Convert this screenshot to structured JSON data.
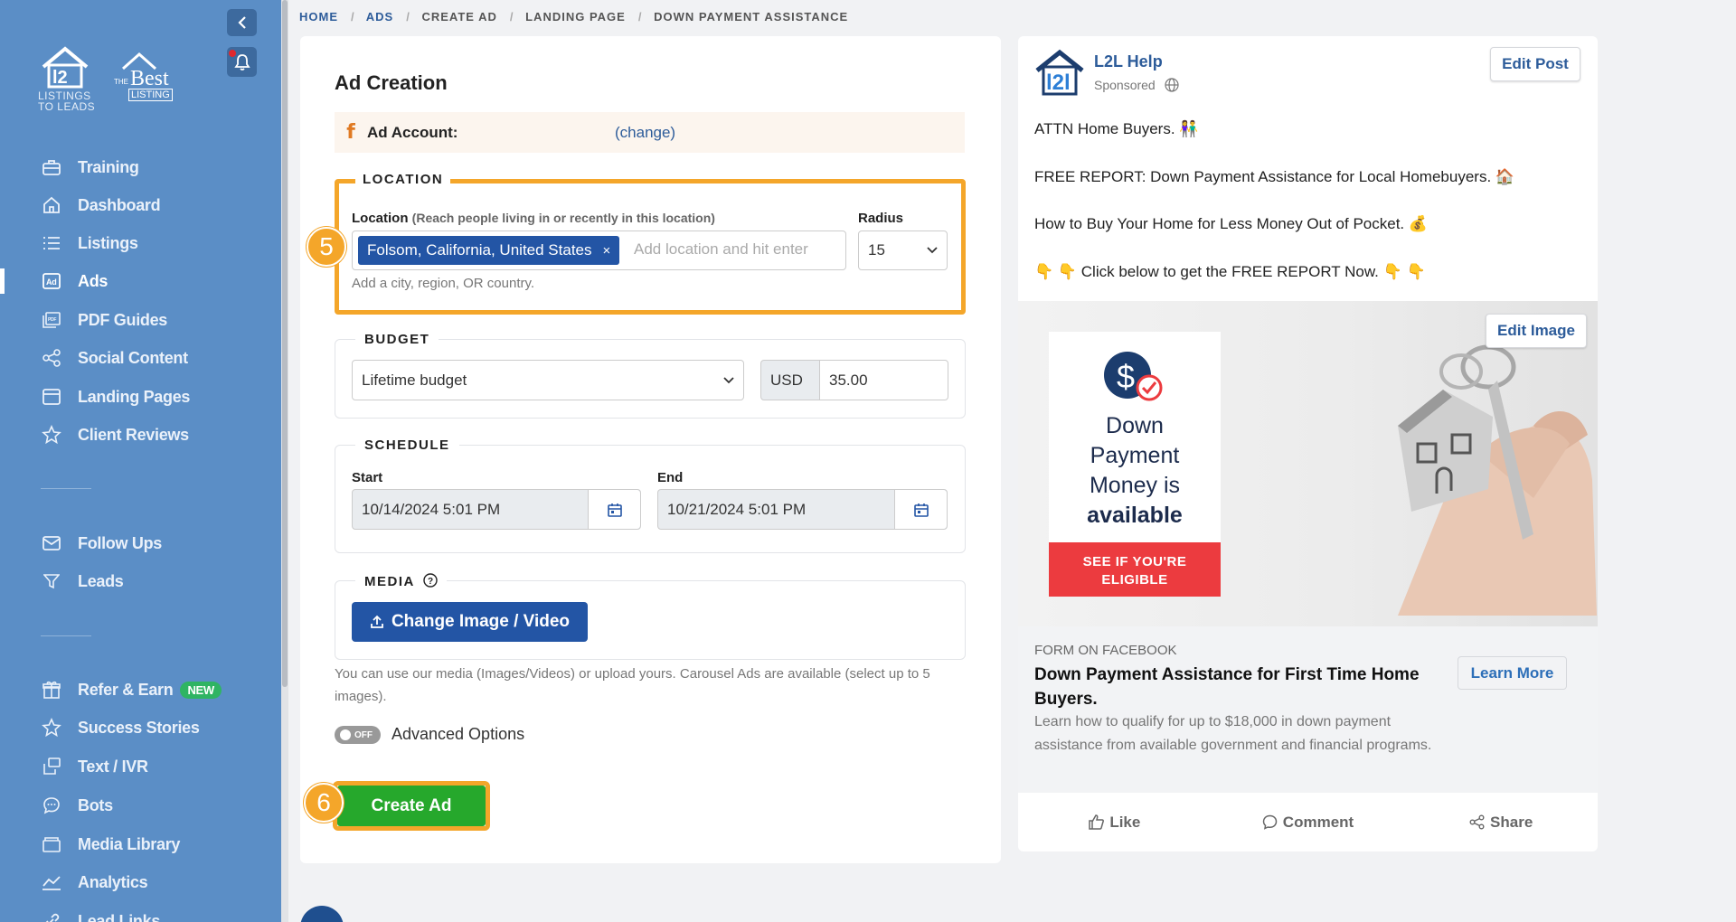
{
  "sidebar": {
    "logo1_caption_line1": "LISTINGS",
    "logo1_caption_line2": "TO LEADS",
    "logo2_the": "THE",
    "logo2_best": "Best",
    "logo2_listing": "LISTING",
    "items": [
      {
        "label": "Training",
        "icon": "briefcase-icon"
      },
      {
        "label": "Dashboard",
        "icon": "home-icon"
      },
      {
        "label": "Listings",
        "icon": "list-icon"
      },
      {
        "label": "Ads",
        "icon": "ad-icon"
      },
      {
        "label": "PDF Guides",
        "icon": "pdf-icon"
      },
      {
        "label": "Social Content",
        "icon": "share-icon"
      },
      {
        "label": "Landing Pages",
        "icon": "window-icon"
      },
      {
        "label": "Client Reviews",
        "icon": "star-icon"
      },
      {
        "label": "Follow Ups",
        "icon": "mail-icon"
      },
      {
        "label": "Leads",
        "icon": "filter-icon"
      },
      {
        "label": "Refer & Earn",
        "icon": "gift-icon",
        "badge": "NEW"
      },
      {
        "label": "Success Stories",
        "icon": "star-icon"
      },
      {
        "label": "Text / IVR",
        "icon": "phone-icon"
      },
      {
        "label": "Bots",
        "icon": "chat-icon"
      },
      {
        "label": "Media Library",
        "icon": "folder-icon"
      },
      {
        "label": "Analytics",
        "icon": "chart-icon"
      },
      {
        "label": "Lead Links",
        "icon": "link-icon"
      }
    ]
  },
  "breadcrumb": [
    "HOME",
    "ADS",
    "CREATE AD",
    "LANDING PAGE",
    "DOWN PAYMENT ASSISTANCE"
  ],
  "form": {
    "title": "Ad Creation",
    "account_label": "Ad Account:",
    "account_change": "(change)",
    "location": {
      "legend": "LOCATION",
      "label": "Location",
      "label_hint": "(Reach people living in or recently in this location)",
      "tag": "Folsom, California, United States",
      "tag_remove": "×",
      "placeholder": "Add location and hit enter",
      "help": "Add a city, region, OR country.",
      "radius_label": "Radius",
      "radius_value": "15"
    },
    "budget": {
      "legend": "BUDGET",
      "type": "Lifetime budget",
      "currency": "USD",
      "amount": "35.00"
    },
    "schedule": {
      "legend": "SCHEDULE",
      "start_label": "Start",
      "start_value": "10/14/2024 5:01 PM",
      "end_label": "End",
      "end_value": "10/21/2024 5:01 PM"
    },
    "media": {
      "legend": "MEDIA",
      "button": "Change Image / Video",
      "note": "You can use our media (Images/Videos) or upload yours. Carousel Ads are available (select up to 5 images)."
    },
    "advanced": {
      "toggle": "OFF",
      "label": "Advanced Options"
    },
    "create_button": "Create Ad",
    "steps": [
      "5",
      "6"
    ]
  },
  "preview": {
    "page_name": "L2L Help",
    "sponsored": "Sponsored",
    "edit_post": "Edit Post",
    "lines": [
      "ATTN Home Buyers. 👫",
      "FREE REPORT: Down Payment Assistance for Local Homebuyers. 🏠",
      "How to Buy Your Home for Less Money Out of Pocket. 💰",
      "👇 👇 Click below to get the FREE REPORT Now. 👇 👇"
    ],
    "edit_image": "Edit Image",
    "flyer": {
      "line1": "Down",
      "line2": "Payment",
      "line3": "Money is",
      "line4": "available",
      "cta_line1": "SEE IF YOU'RE",
      "cta_line2": "ELIGIBLE"
    },
    "form_label": "FORM ON FACEBOOK",
    "headline": "Down Payment Assistance for First Time Home Buyers.",
    "description": "Learn how to qualify for up to $18,000 in down payment assistance from available government and financial programs.",
    "learn_more": "Learn More",
    "actions": [
      "Like",
      "Comment",
      "Share"
    ]
  },
  "colors": {
    "sidebar": "#5b8ec6",
    "highlight": "#f4a62a",
    "primary": "#2355a5",
    "success": "#26a82c"
  }
}
